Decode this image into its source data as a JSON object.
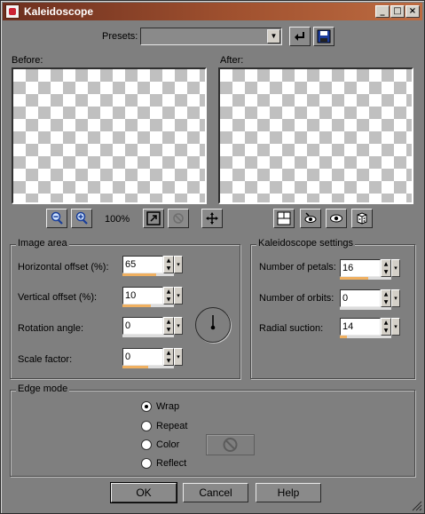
{
  "window": {
    "title": "Kaleidoscope"
  },
  "presets": {
    "label": "Presets:",
    "value": ""
  },
  "previews": {
    "before_label": "Before:",
    "after_label": "After:",
    "zoom": "100%"
  },
  "image_area": {
    "title": "Image area",
    "fields": [
      {
        "label": "Horizontal offset (%):",
        "value": "65",
        "fill": 0.65
      },
      {
        "label": "Vertical offset (%):",
        "value": "10",
        "fill": 0.55
      },
      {
        "label": "Rotation angle:",
        "value": "0",
        "fill": 0.0
      },
      {
        "label": "Scale factor:",
        "value": "0",
        "fill": 0.5
      }
    ]
  },
  "kaleidoscope": {
    "title": "Kaleidoscope settings",
    "fields": [
      {
        "label": "Number of petals:",
        "value": "16",
        "fill": 0.55
      },
      {
        "label": "Number of orbits:",
        "value": "0",
        "fill": 0.0
      },
      {
        "label": "Radial suction:",
        "value": "14",
        "fill": 0.14
      }
    ]
  },
  "edge_mode": {
    "title": "Edge mode",
    "options": [
      "Wrap",
      "Repeat",
      "Color",
      "Reflect"
    ],
    "selected": "Wrap"
  },
  "buttons": {
    "ok": "OK",
    "cancel": "Cancel",
    "help": "Help"
  },
  "colors": {
    "title_start": "#6c2f1f",
    "title_end": "#bd6b41",
    "slider_fill": "#f0b060",
    "dialog_bg": "#7f7f7f"
  }
}
